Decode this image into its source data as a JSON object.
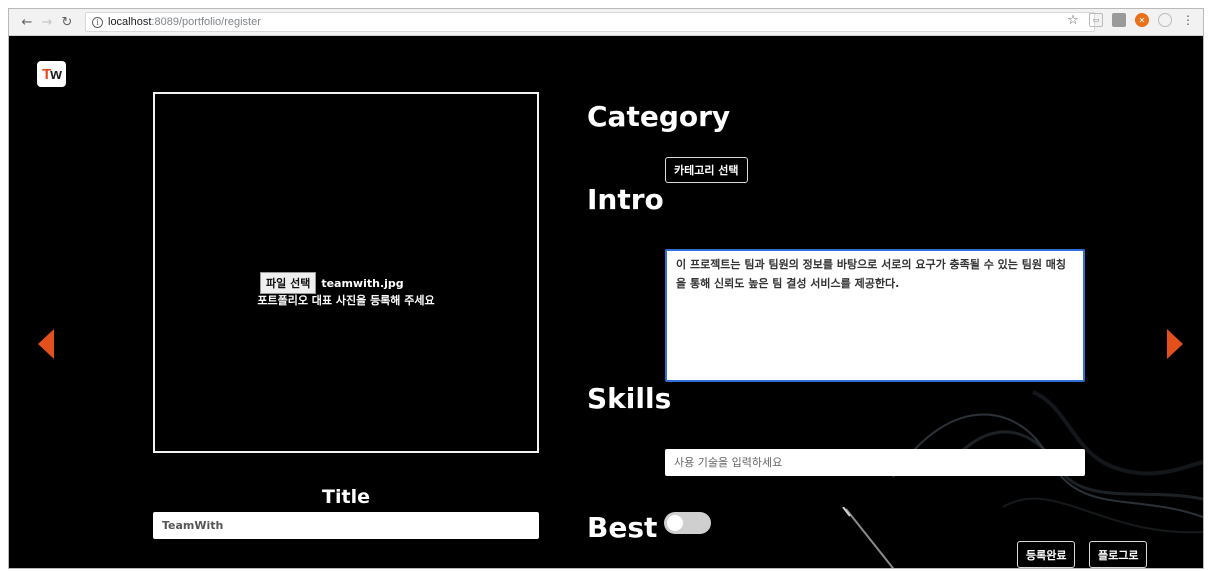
{
  "browser": {
    "url_host": "localhost",
    "url_rest": ":8089/portfolio/register"
  },
  "logo": {
    "t": "T",
    "w": "w"
  },
  "photo": {
    "file_button": "파일 선택",
    "file_name": "teamwith.jpg",
    "hint": "포트폴리오 대표 사진을 등록해 주세요"
  },
  "title": {
    "label": "Title",
    "value": "TeamWith"
  },
  "category": {
    "label": "Category",
    "button": "카테고리 선택"
  },
  "intro": {
    "label": "Intro",
    "value": "이 프로젝트는 팀과 팀원의 정보를 바탕으로 서로의 요구가 충족될 수 있는 팀원 매칭을 통해 신뢰도 높은 팀 결성 서비스를 제공한다."
  },
  "skills": {
    "label": "Skills",
    "placeholder": "사용 기술을 입력하세요"
  },
  "best": {
    "label": "Best",
    "enabled": false
  },
  "actions": {
    "submit": "등록완료",
    "back": "플로그로"
  },
  "colors": {
    "accent": "#e2501d",
    "focus": "#2f6fd6",
    "background": "#000000"
  }
}
